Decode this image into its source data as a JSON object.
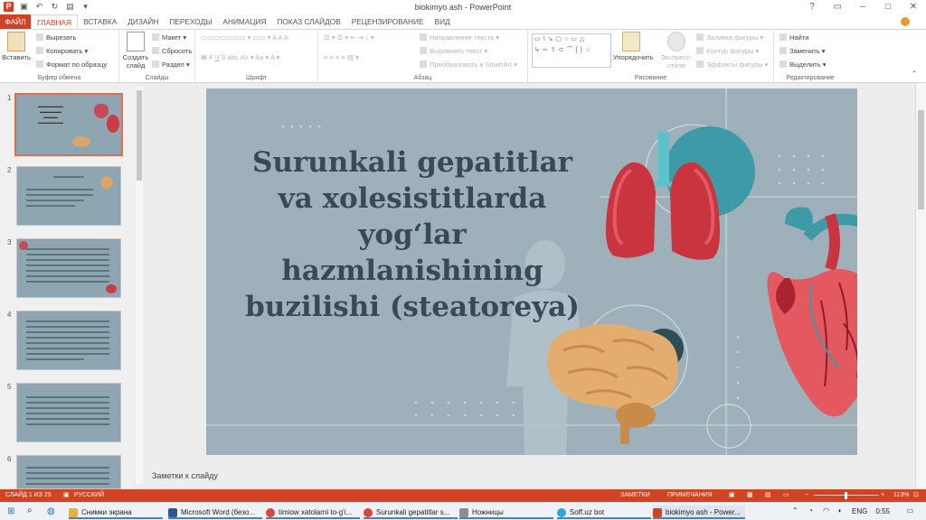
{
  "window": {
    "title": "biokimyo ash - PowerPoint"
  },
  "tabs": [
    "ФАЙЛ",
    "ГЛАВНАЯ",
    "ВСТАВКА",
    "ДИЗАЙН",
    "ПЕРЕХОДЫ",
    "АНИМАЦИЯ",
    "ПОКАЗ СЛАЙДОВ",
    "РЕЦЕНЗИРОВАНИЕ",
    "ВИД"
  ],
  "ribbon": {
    "clipboard": {
      "paste": "Вставить",
      "cut": "Вырезать",
      "copy": "Копировать",
      "format_painter": "Формат по образцу",
      "label": "Буфер обмена"
    },
    "slides": {
      "new_slide": "Создать слайд",
      "layout": "Макет",
      "reset": "Сбросить",
      "section": "Раздел",
      "label": "Слайды"
    },
    "font": {
      "label": "Шрифт"
    },
    "paragraph": {
      "text_direction": "Направление текста",
      "align_text": "Выровнять текст",
      "smartart": "Преобразовать в SmartArt",
      "label": "Абзац"
    },
    "drawing": {
      "arrange": "Упорядочить",
      "quick_styles": "Экспресс-стили",
      "fill": "Заливка фигуры",
      "outline": "Контур фигуры",
      "effects": "Эффекты фигуры",
      "label": "Рисование"
    },
    "editing": {
      "find": "Найти",
      "replace": "Заменить",
      "select": "Выделить",
      "label": "Редактирование"
    }
  },
  "thumbnails": [
    "1",
    "2",
    "3",
    "4",
    "5",
    "6"
  ],
  "slide": {
    "title": "Surunkali gepatitlar va xolesistitlarda yog‘lar hazmlanishining buzilishi (steatoreya)"
  },
  "notes_placeholder": "Заметки к слайду",
  "status": {
    "slide_counter": "СЛАЙД 1 ИЗ 25",
    "language": "РУССКИЙ",
    "notes": "ЗАМЕТКИ",
    "comments": "ПРИМЕЧАНИЯ",
    "zoom": "113%"
  },
  "taskbar": {
    "items": [
      "Снимки экрана",
      "Microsoft Word (безо...",
      "timiow xatolarni to-g'i...",
      "Surunkali gepatitlar s...",
      "Ножницы",
      "Soff.uz bot",
      "biokimyo ash - Power..."
    ],
    "lang": "ENG",
    "time": "0:55"
  },
  "colors": {
    "accent": "#d04423",
    "slide_bg": "#9eb1bb"
  }
}
